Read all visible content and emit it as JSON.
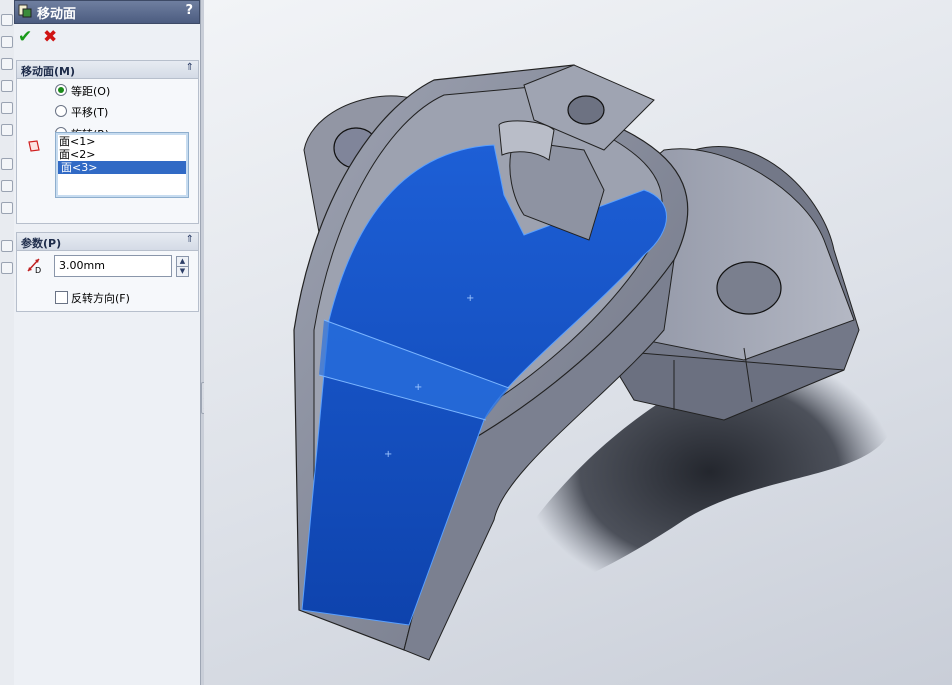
{
  "panel": {
    "title": "移动面",
    "help": "?",
    "ok_symbol": "✔",
    "cancel_symbol": "✖",
    "move_group": {
      "title": "移动面(M)",
      "collapse_symbol": "⇑",
      "options": [
        {
          "label": "等距(O)",
          "selected": true
        },
        {
          "label": "平移(T)",
          "selected": false
        },
        {
          "label": "旋转(R)",
          "selected": false
        }
      ],
      "faces": [
        "面<1>",
        "面<2>",
        "面<3>"
      ],
      "selected_face": "面<3>"
    },
    "params_group": {
      "title": "参数(P)",
      "collapse_symbol": "⇑",
      "distance_value": "3.00mm",
      "distance_icon_label": "D",
      "reverse_label": "反转方向(F)",
      "reverse_checked": false
    }
  },
  "colors": {
    "selected_face_blue": "#1a56c8",
    "model_gray": "#8a8f9e",
    "title_bar": "#5a6a8e"
  },
  "icons": [
    "property-manager-icon",
    "checkmark-icon",
    "close-icon",
    "collapse-icon",
    "face-icon",
    "distance-icon",
    "spin-up-icon",
    "spin-down-icon"
  ]
}
